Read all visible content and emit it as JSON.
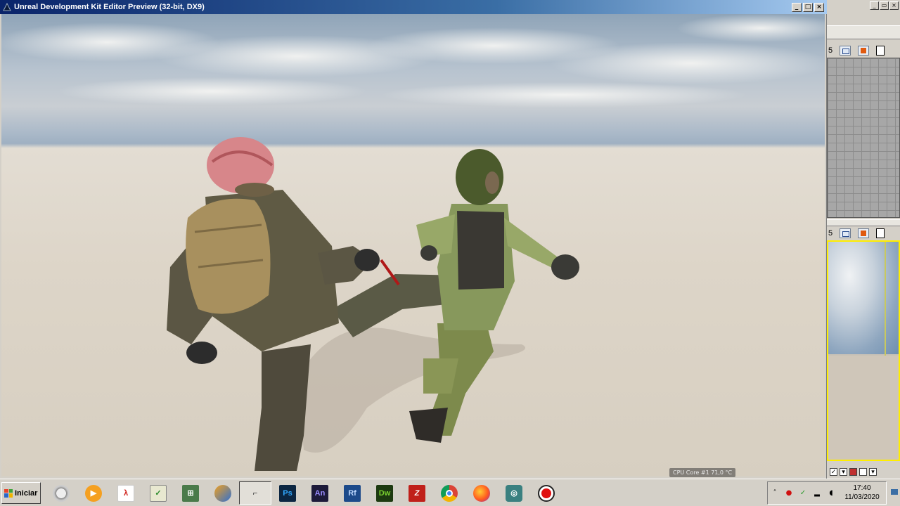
{
  "window": {
    "title": "Unreal Development Kit Editor Preview (32-bit, DX9)",
    "buttons": [
      "_",
      "□",
      "×"
    ]
  },
  "viewport": {
    "cpu_readout": "CPU Core #1  71,0 °C"
  },
  "editor_panel": {
    "window_buttons": [
      "_",
      "▭",
      "×"
    ],
    "viewport_number": "5"
  },
  "taskbar": {
    "start_label": "Iniciar",
    "apps": [
      {
        "name": "Speedometer",
        "label": ""
      },
      {
        "name": "Media Player",
        "label": ""
      },
      {
        "name": "Acrobat",
        "label": ""
      },
      {
        "name": "Task Manager",
        "label": ""
      },
      {
        "name": "Network Tool",
        "label": ""
      },
      {
        "name": "Components",
        "label": ""
      },
      {
        "name": "Unreal Preview",
        "label": ""
      },
      {
        "name": "Photoshop",
        "label": "Ps"
      },
      {
        "name": "Animate",
        "label": "An"
      },
      {
        "name": "Reflow",
        "label": "Rf"
      },
      {
        "name": "Dreamweaver",
        "label": "Dw"
      },
      {
        "name": "FileZilla",
        "label": ""
      },
      {
        "name": "Chrome",
        "label": ""
      },
      {
        "name": "Firefox",
        "label": ""
      },
      {
        "name": "Network Monitor",
        "label": ""
      },
      {
        "name": "Recorder",
        "label": ""
      }
    ],
    "clock_time": "17:40",
    "clock_date": "11/03/2020"
  }
}
